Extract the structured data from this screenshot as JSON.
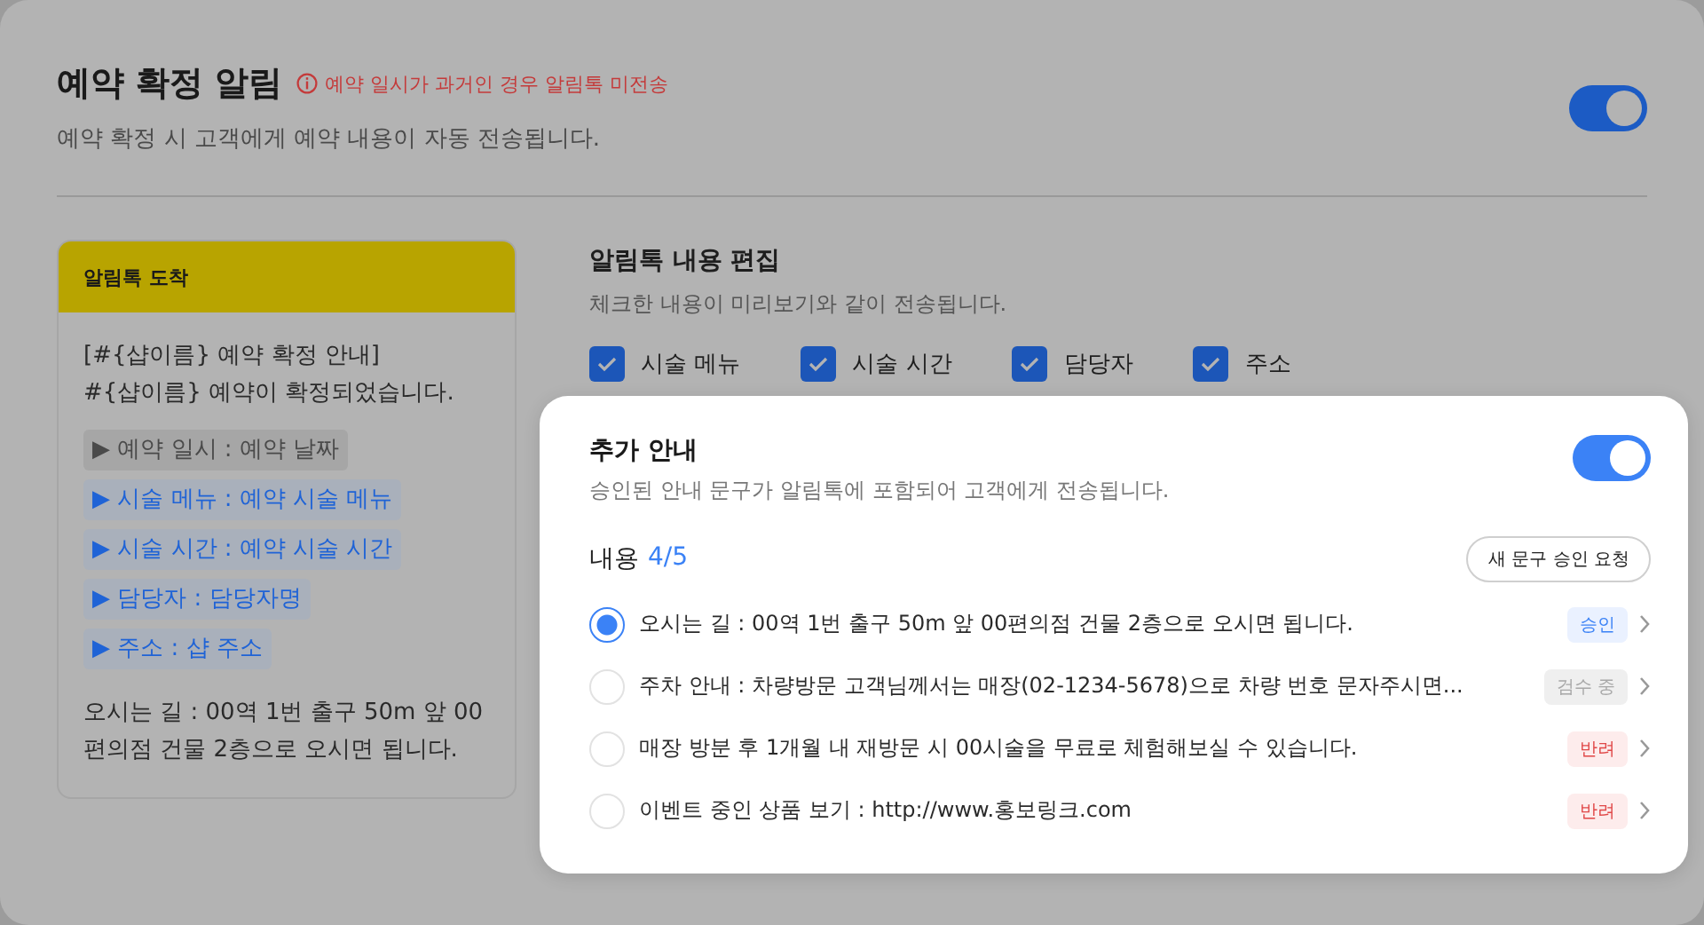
{
  "header": {
    "title": "예약 확정 알림",
    "warning": "예약 일시가 과거인 경우 알림톡 미전송",
    "description": "예약 확정 시 고객에게 예약 내용이 자동 전송됩니다.",
    "toggle_on": true
  },
  "preview": {
    "title": "알림톡 도착",
    "lines": [
      "[#{샵이름} 예약 확정 안내]",
      "#{샵이름} 예약이 확정되었습니다."
    ],
    "items": [
      {
        "text": "▶ 예약 일시 : 예약 날짜",
        "active": false
      },
      {
        "text": "▶ 시술 메뉴 : 예약 시술 메뉴",
        "active": true
      },
      {
        "text": "▶ 시술 시간 : 예약 시술 시간",
        "active": true
      },
      {
        "text": "▶ 담당자 : 담당자명",
        "active": true
      },
      {
        "text": "▶ 주소 : 샵 주소",
        "active": true
      }
    ],
    "footer": "오시는 길 : 00역 1번 출구 50m 앞 00편의점 건물 2층으로 오시면 됩니다."
  },
  "editor": {
    "title": "알림톡 내용 편집",
    "description": "체크한 내용이 미리보기와 같이 전송됩니다.",
    "checkboxes": [
      {
        "label": "시술 메뉴",
        "checked": true
      },
      {
        "label": "시술 시간",
        "checked": true
      },
      {
        "label": "담당자",
        "checked": true
      },
      {
        "label": "주소",
        "checked": true
      }
    ]
  },
  "extra": {
    "title": "추가 안내",
    "description": "승인된 안내 문구가 알림톡에 포함되어 고객에게 전송됩니다.",
    "toggle_on": true,
    "content_label": "내용",
    "count": "4/5",
    "request_button": "새 문구 승인 요청",
    "options": [
      {
        "text": "오시는 길 : 00역 1번 출구 50m 앞 00편의점 건물 2층으로 오시면 됩니다.",
        "selected": true,
        "status": "승인",
        "kind": "approved"
      },
      {
        "text": "주차 안내 : 차량방문 고객님께서는 매장(02-1234-5678)으로 차량 번호 문자주시면...",
        "selected": false,
        "status": "검수 중",
        "kind": "review"
      },
      {
        "text": "매장 방분 후 1개월 내 재방문 시 00시술을 무료로 체험해보실 수 있습니다.",
        "selected": false,
        "status": "반려",
        "kind": "rejected"
      },
      {
        "text": "이벤트 중인 상품 보기 : http://www.홍보링크.com",
        "selected": false,
        "status": "반려",
        "kind": "rejected"
      }
    ]
  }
}
